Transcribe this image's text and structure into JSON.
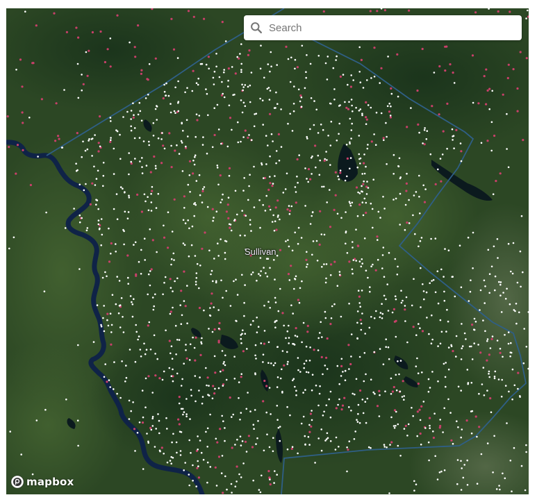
{
  "map": {
    "place_label": "Sullivan",
    "colors": {
      "river": "#0f2347",
      "county_border": "#2f5f86",
      "poi_white": "#ffffff",
      "poi_red": "#c9406a",
      "forest_dark": "#1f3a1c",
      "forest_mid": "#2e4d26",
      "water_lake": "#0b1a1e"
    }
  },
  "search": {
    "placeholder": "Search",
    "icon": "search-icon"
  },
  "attribution": {
    "label": "mapbox",
    "icon": "mapbox-logo-icon"
  }
}
